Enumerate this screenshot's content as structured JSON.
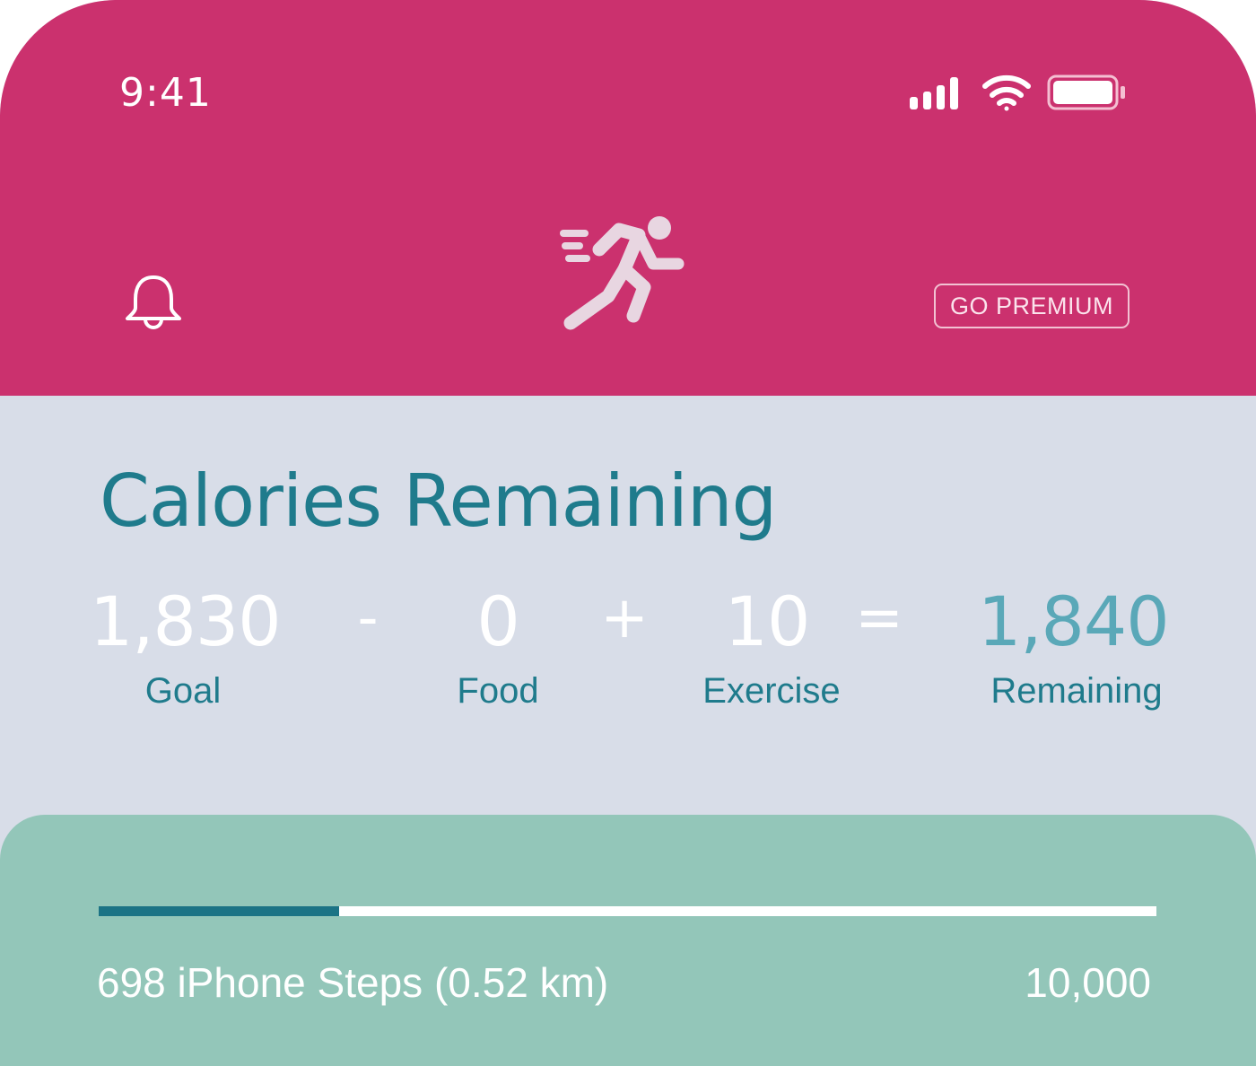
{
  "status_bar": {
    "time": "9:41",
    "icons": [
      "cellular-signal-icon",
      "wifi-icon",
      "battery-icon"
    ]
  },
  "header": {
    "left_icon": "bell-icon",
    "logo_icon": "running-person-icon",
    "premium_label": "GO PREMIUM"
  },
  "calories": {
    "title": "Calories Remaining",
    "goal": {
      "value": "1,830",
      "label": "Goal"
    },
    "minus": "-",
    "food": {
      "value": "0",
      "label": "Food"
    },
    "plus": "+",
    "exercise": {
      "value": "10",
      "label": "Exercise"
    },
    "equals": "=",
    "remaining": {
      "value": "1,840",
      "label": "Remaining"
    }
  },
  "steps": {
    "text": "698 iPhone Steps (0.52 km)",
    "goal": "10,000",
    "progress_percent": 22.7
  },
  "colors": {
    "header": "#cb316e",
    "background": "#d8dde8",
    "accent_teal": "#1f7b8c",
    "remaining_value": "#5aa8b8",
    "steps_card": "#93c6b9",
    "progress_fill": "#1b7385"
  }
}
